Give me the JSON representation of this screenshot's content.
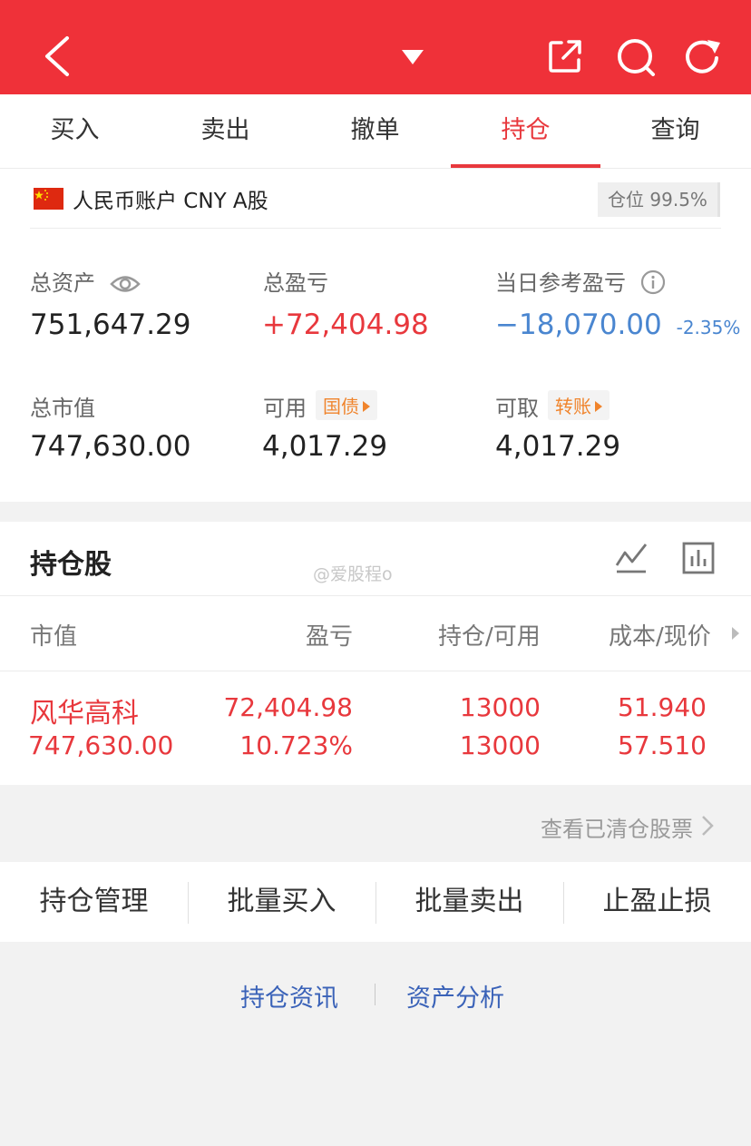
{
  "topbar": {
    "icons": [
      "back-icon",
      "dropdown-caret-icon",
      "share-icon",
      "search-icon",
      "refresh-icon"
    ]
  },
  "tabs": [
    {
      "label": "买入"
    },
    {
      "label": "卖出"
    },
    {
      "label": "撤单"
    },
    {
      "label": "持仓",
      "active": true
    },
    {
      "label": "查询"
    }
  ],
  "account": {
    "label": "人民币账户 CNY A股",
    "position_badge": "仓位 99.5%",
    "total_assets_label": "总资产",
    "total_assets_value": "751,647.29",
    "total_pl_label": "总盈亏",
    "total_pl_value": "+72,404.98",
    "daily_pl_label": "当日参考盈亏",
    "daily_pl_value": "−18,070.00",
    "daily_pl_pct": "-2.35%",
    "market_value_label": "总市值",
    "market_value_value": "747,630.00",
    "available_label": "可用",
    "available_chip": "国债",
    "available_value": "4,017.29",
    "withdrawable_label": "可取",
    "withdrawable_chip": "转账",
    "withdrawable_value": "4,017.29"
  },
  "holdings": {
    "title": "持仓股",
    "watermark": "@爱股程o",
    "columns": [
      "市值",
      "盈亏",
      "持仓/可用",
      "成本/现价"
    ],
    "rows": [
      {
        "name": "风华高科",
        "market_value": "747,630.00",
        "pl": "72,404.98",
        "pl_pct": "10.723%",
        "position": "13000",
        "available": "13000",
        "cost": "51.940",
        "price": "57.510"
      }
    ]
  },
  "cleared_link": "查看已清仓股票",
  "actions": [
    "持仓管理",
    "批量买入",
    "批量卖出",
    "止盈止损"
  ],
  "bottom_links": [
    "持仓资讯",
    "资产分析"
  ],
  "colors": {
    "brand_red": "#ef3139",
    "loss_blue": "#4a86d0",
    "chip_orange": "#f0842c",
    "link_blue": "#3a62b8"
  }
}
